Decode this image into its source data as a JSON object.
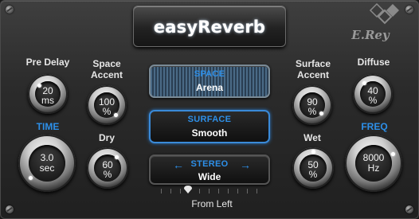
{
  "header": {
    "title": "easyReverb",
    "logo_text": "E.Rey"
  },
  "knobs": {
    "pre_delay": {
      "label": "Pre Delay",
      "value": "20",
      "unit": "ms"
    },
    "space_accent": {
      "label_line1": "Space",
      "label_line2": "Accent",
      "value": "100",
      "unit": "%"
    },
    "time": {
      "label": "TIME",
      "value": "3.0",
      "unit": "sec"
    },
    "dry": {
      "label": "Dry",
      "value": "60",
      "unit": "%"
    },
    "surface_accent": {
      "label_line1": "Surface",
      "label_line2": "Accent",
      "value": "90",
      "unit": "%"
    },
    "diffuse": {
      "label": "Diffuse",
      "value": "40",
      "unit": "%"
    },
    "wet": {
      "label": "Wet",
      "value": "50",
      "unit": "%"
    },
    "freq": {
      "label": "FREQ",
      "value": "8000",
      "unit": "Hz"
    }
  },
  "buttons": {
    "space": {
      "title": "SPACE",
      "value": "Arena"
    },
    "surface": {
      "title": "SURFACE",
      "value": "Smooth"
    },
    "stereo": {
      "title": "STEREO",
      "value": "Wide"
    }
  },
  "pan": {
    "label": "From Left"
  },
  "colors": {
    "accent_blue": "#2d8fe8",
    "panel": "#2b2b2b",
    "text": "#e6e6e6"
  }
}
